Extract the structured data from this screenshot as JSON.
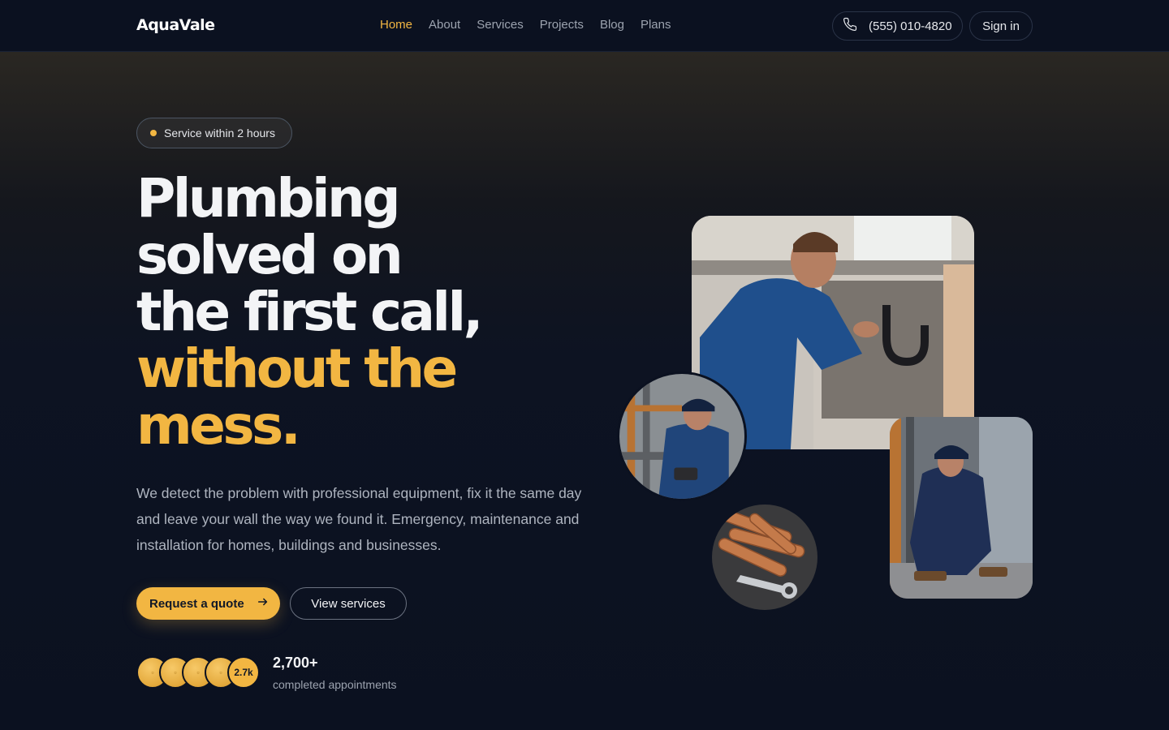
{
  "header": {
    "logo": "AquaVale",
    "nav": [
      "Home",
      "About",
      "Services",
      "Projects",
      "Blog",
      "Plans"
    ],
    "active_nav": "Home",
    "phone": "(555) 010-4820",
    "signin": "Sign in"
  },
  "hero": {
    "badge": "Service within 2 hours",
    "headline_lines": [
      "Plumbing",
      "solved on",
      "the first call,"
    ],
    "headline_accent_lines": [
      "without the",
      "mess."
    ],
    "description": "We detect the problem with professional equipment, fix it the same day and leave your wall the way we found it. Emergency, maintenance and installation for homes, buildings and businesses.",
    "cta_primary": "Request a quote",
    "cta_secondary": "View services",
    "avatar_count": "2.7k",
    "stat_number": "2,700+",
    "stat_label": "completed appointments"
  },
  "icons": {
    "phone": "phone-icon",
    "arrow": "arrow-right-icon"
  },
  "colors": {
    "accent": "#f2b642",
    "background": "#0b1120",
    "text": "#f3f4f6",
    "muted": "#9ca3af"
  }
}
